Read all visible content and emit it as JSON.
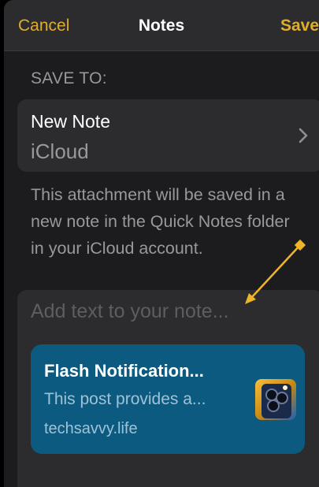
{
  "navbar": {
    "cancel_label": "Cancel",
    "title": "Notes",
    "save_label": "Save"
  },
  "save_to": {
    "header": "SAVE TO:",
    "destination_title": "New Note",
    "destination_account": "iCloud"
  },
  "info_text": "This attachment will be saved in a new note in the Quick Notes folder in your iCloud account.",
  "compose": {
    "placeholder": "Add text to your note..."
  },
  "link_preview": {
    "title": "Flash Notification...",
    "description": "This post provides a...",
    "domain": "techsavvy.life"
  },
  "colors": {
    "accent": "#e0ad2b",
    "card_background": "#0c5a80",
    "annotation_arrow": "#f0b429"
  },
  "icons": [
    "chevron-right-icon",
    "link-thumbnail",
    "annotation-arrow"
  ]
}
